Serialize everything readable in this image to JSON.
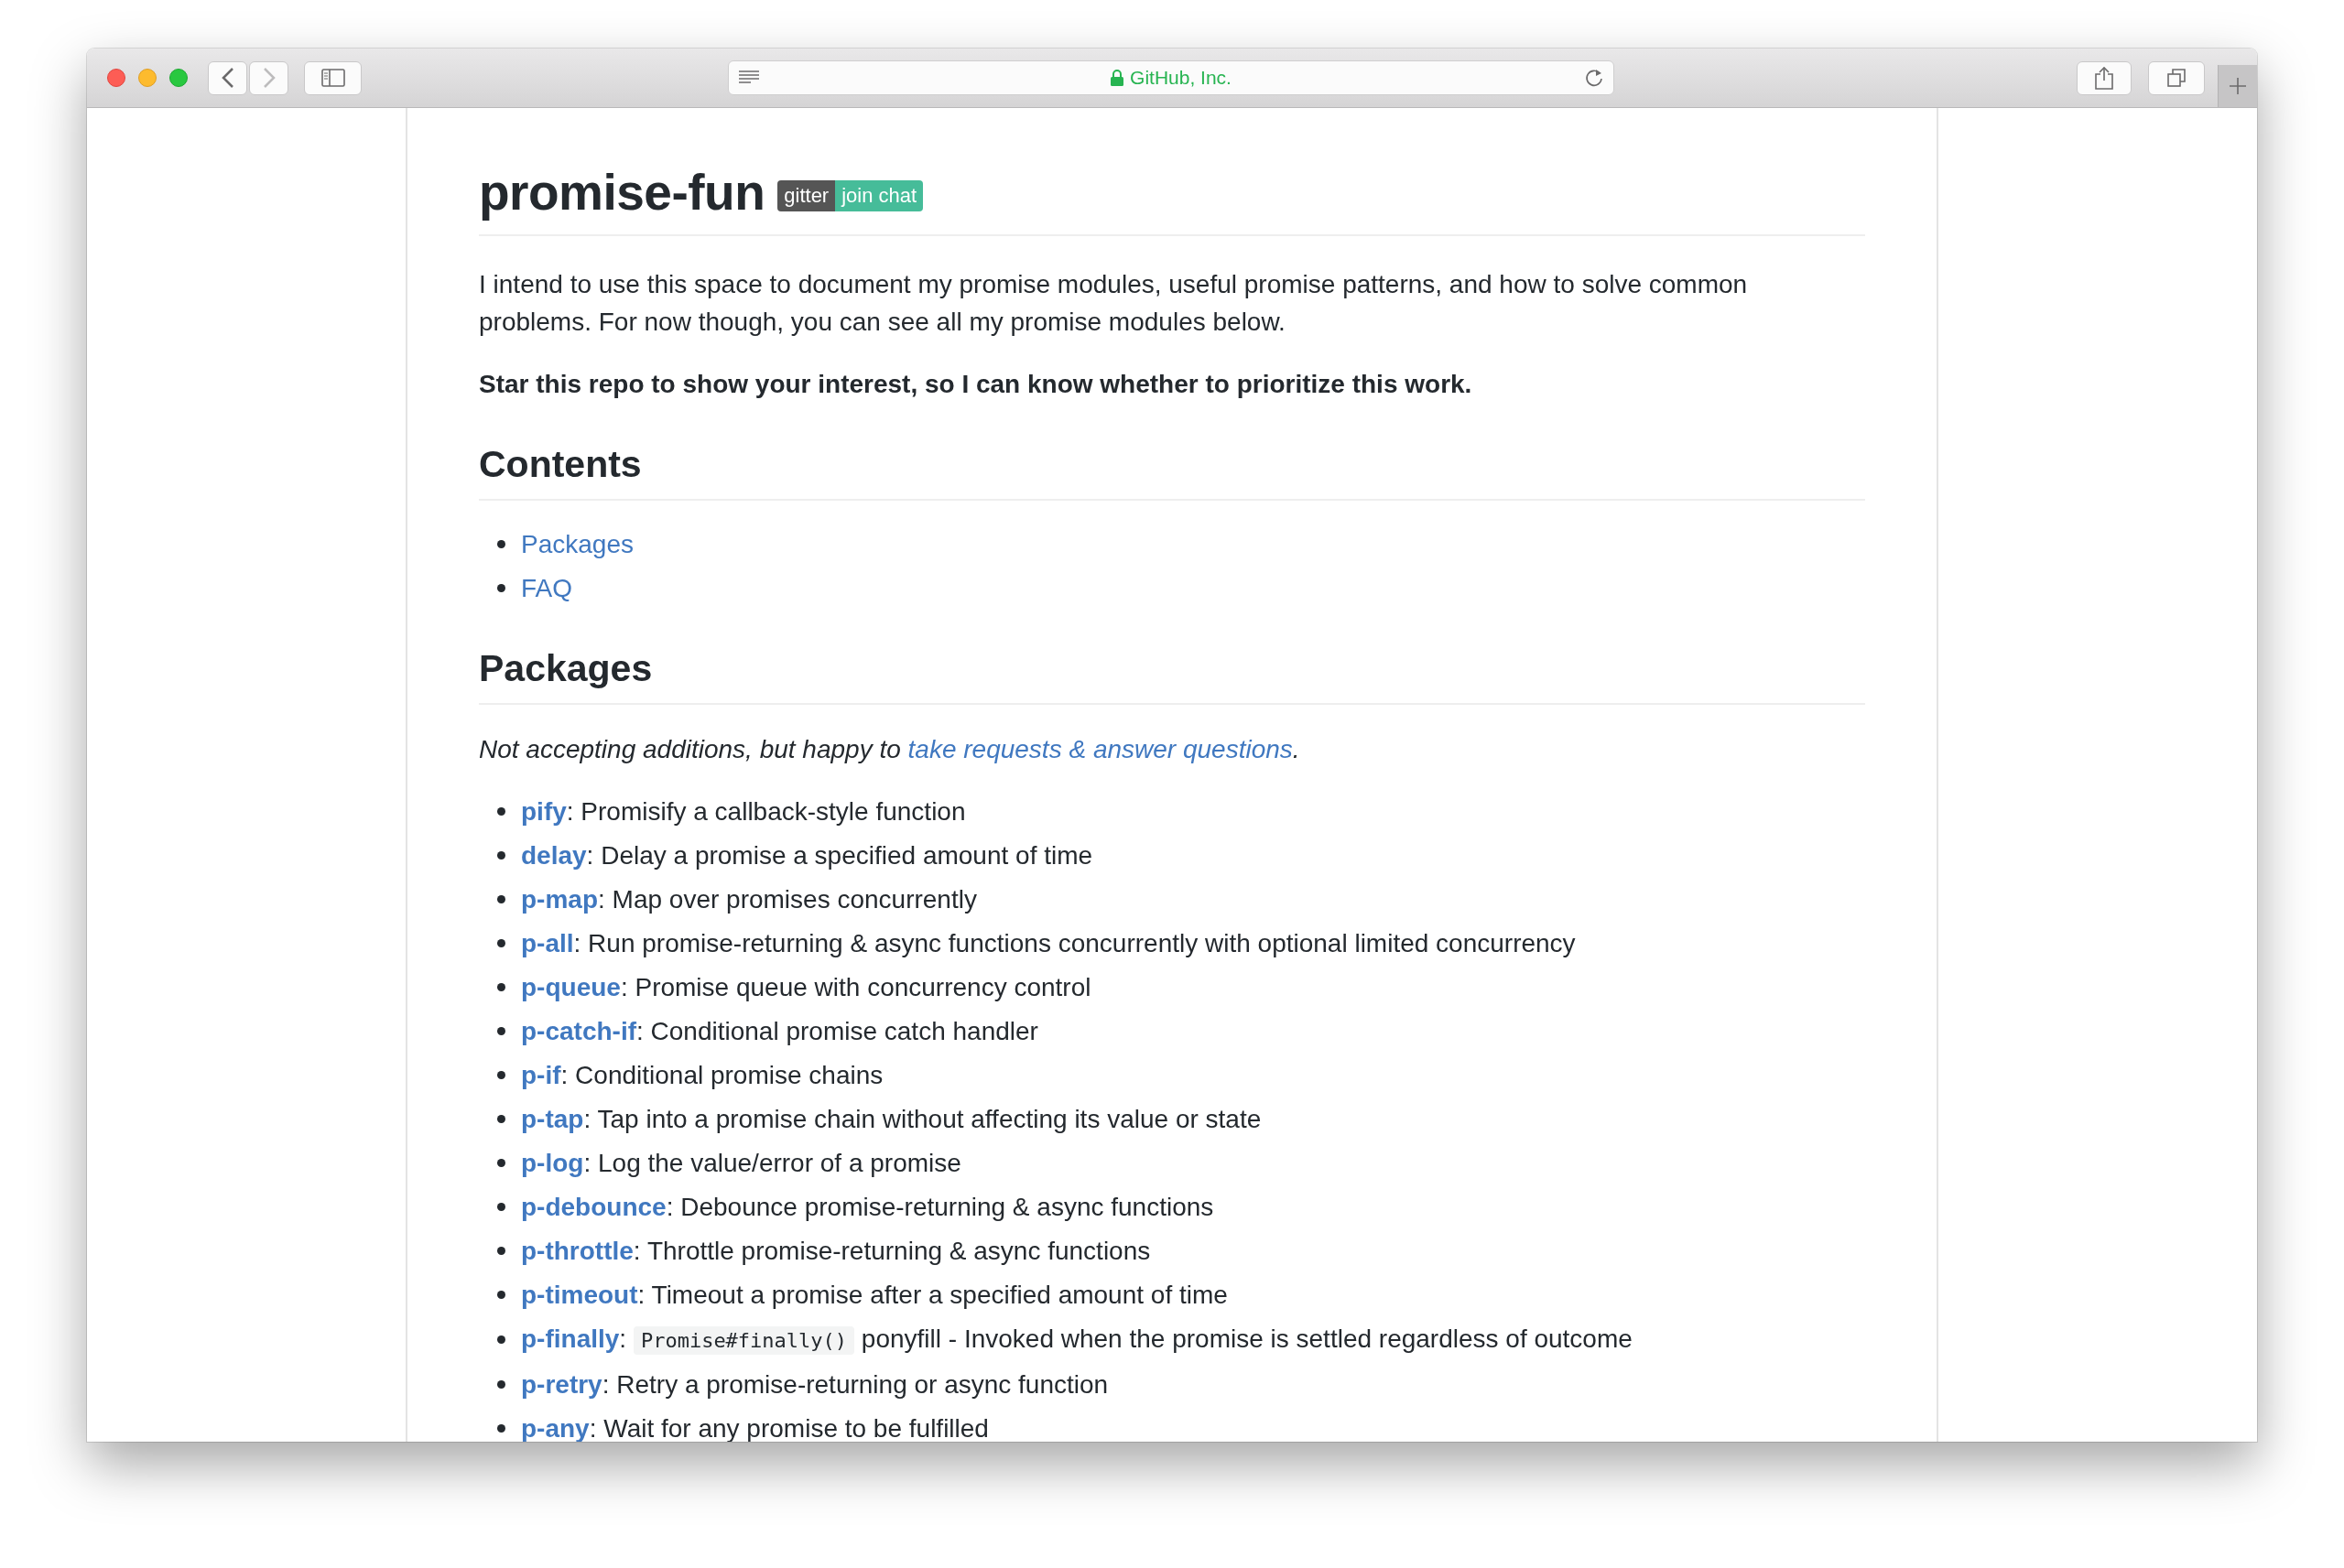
{
  "window": {
    "address": "GitHub, Inc.",
    "navigation": [
      {
        "kind": "back",
        "disabled": false
      },
      {
        "kind": "forward",
        "disabled": true
      }
    ]
  },
  "readme": {
    "title": "promise-fun",
    "badge": {
      "left": "gitter",
      "right": "join chat"
    },
    "intro": "I intend to use this space to document my promise modules, useful promise patterns, and how to solve common problems. For now though, you can see all my promise modules below.",
    "call_to_action": "Star this repo to show your interest, so I can know whether to prioritize this work.",
    "contents": {
      "heading": "Contents",
      "items": [
        "Packages",
        "FAQ"
      ]
    },
    "packages": {
      "heading": "Packages",
      "note_before": "Not accepting additions, but happy to ",
      "note_link": "take requests & answer questions",
      "note_after": ".",
      "items": [
        {
          "name": "pify",
          "description": ": Promisify a callback-style function"
        },
        {
          "name": "delay",
          "description": ": Delay a promise a specified amount of time"
        },
        {
          "name": "p-map",
          "description": ": Map over promises concurrently"
        },
        {
          "name": "p-all",
          "description": ": Run promise-returning & async functions concurrently with optional limited concurrency"
        },
        {
          "name": "p-queue",
          "description": ": Promise queue with concurrency control"
        },
        {
          "name": "p-catch-if",
          "description": ": Conditional promise catch handler"
        },
        {
          "name": "p-if",
          "description": ": Conditional promise chains"
        },
        {
          "name": "p-tap",
          "description": ": Tap into a promise chain without affecting its value or state"
        },
        {
          "name": "p-log",
          "description": ": Log the value/error of a promise"
        },
        {
          "name": "p-debounce",
          "description": ": Debounce promise-returning & async functions"
        },
        {
          "name": "p-throttle",
          "description": ": Throttle promise-returning & async functions"
        },
        {
          "name": "p-timeout",
          "description": ": Timeout a promise after a specified amount of time"
        },
        {
          "name": "p-finally",
          "description": ": ",
          "code": "Promise#finally()",
          "after": " ponyfill - Invoked when the promise is settled regardless of outcome"
        },
        {
          "name": "p-retry",
          "description": ": Retry a promise-returning or async function"
        },
        {
          "name": "p-any",
          "description": ": Wait for any promise to be fulfilled"
        }
      ]
    }
  }
}
